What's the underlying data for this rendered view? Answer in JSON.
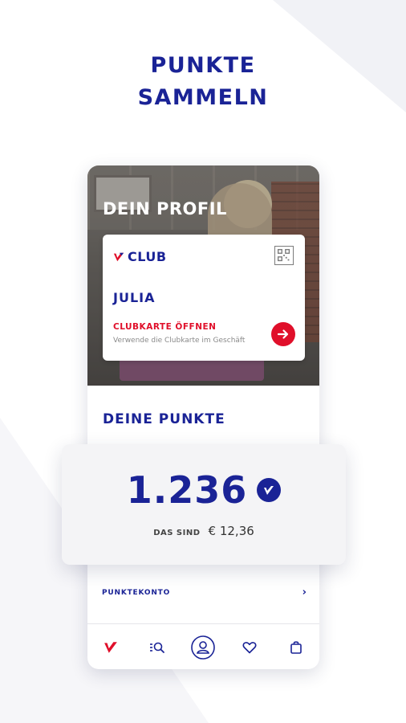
{
  "headline": {
    "line1": "PUNKTE",
    "line2": "SAMMELN"
  },
  "profile": {
    "title": "DEIN PROFIL",
    "card": {
      "brand_label": "CLUB",
      "name": "JULIA",
      "open_label": "CLUBKARTE ÖFFNEN",
      "open_hint": "Verwende die Clubkarte im Geschäft"
    }
  },
  "points": {
    "title": "DEINE PUNKTE",
    "value": "1.236",
    "equivalent_label": "DAS SIND",
    "equivalent_value": "€ 12,36"
  },
  "account_link": {
    "label": "PUNKTEKONTO"
  },
  "colors": {
    "brand_blue": "#1a2396",
    "accent_red": "#e00f2a"
  },
  "tabbar": {
    "items": [
      {
        "icon": "brand-logo-icon",
        "active": true
      },
      {
        "icon": "search-list-icon",
        "active": false
      },
      {
        "icon": "profile-icon",
        "active": false
      },
      {
        "icon": "heart-icon",
        "active": false
      },
      {
        "icon": "shopping-bag-icon",
        "active": false
      }
    ]
  }
}
